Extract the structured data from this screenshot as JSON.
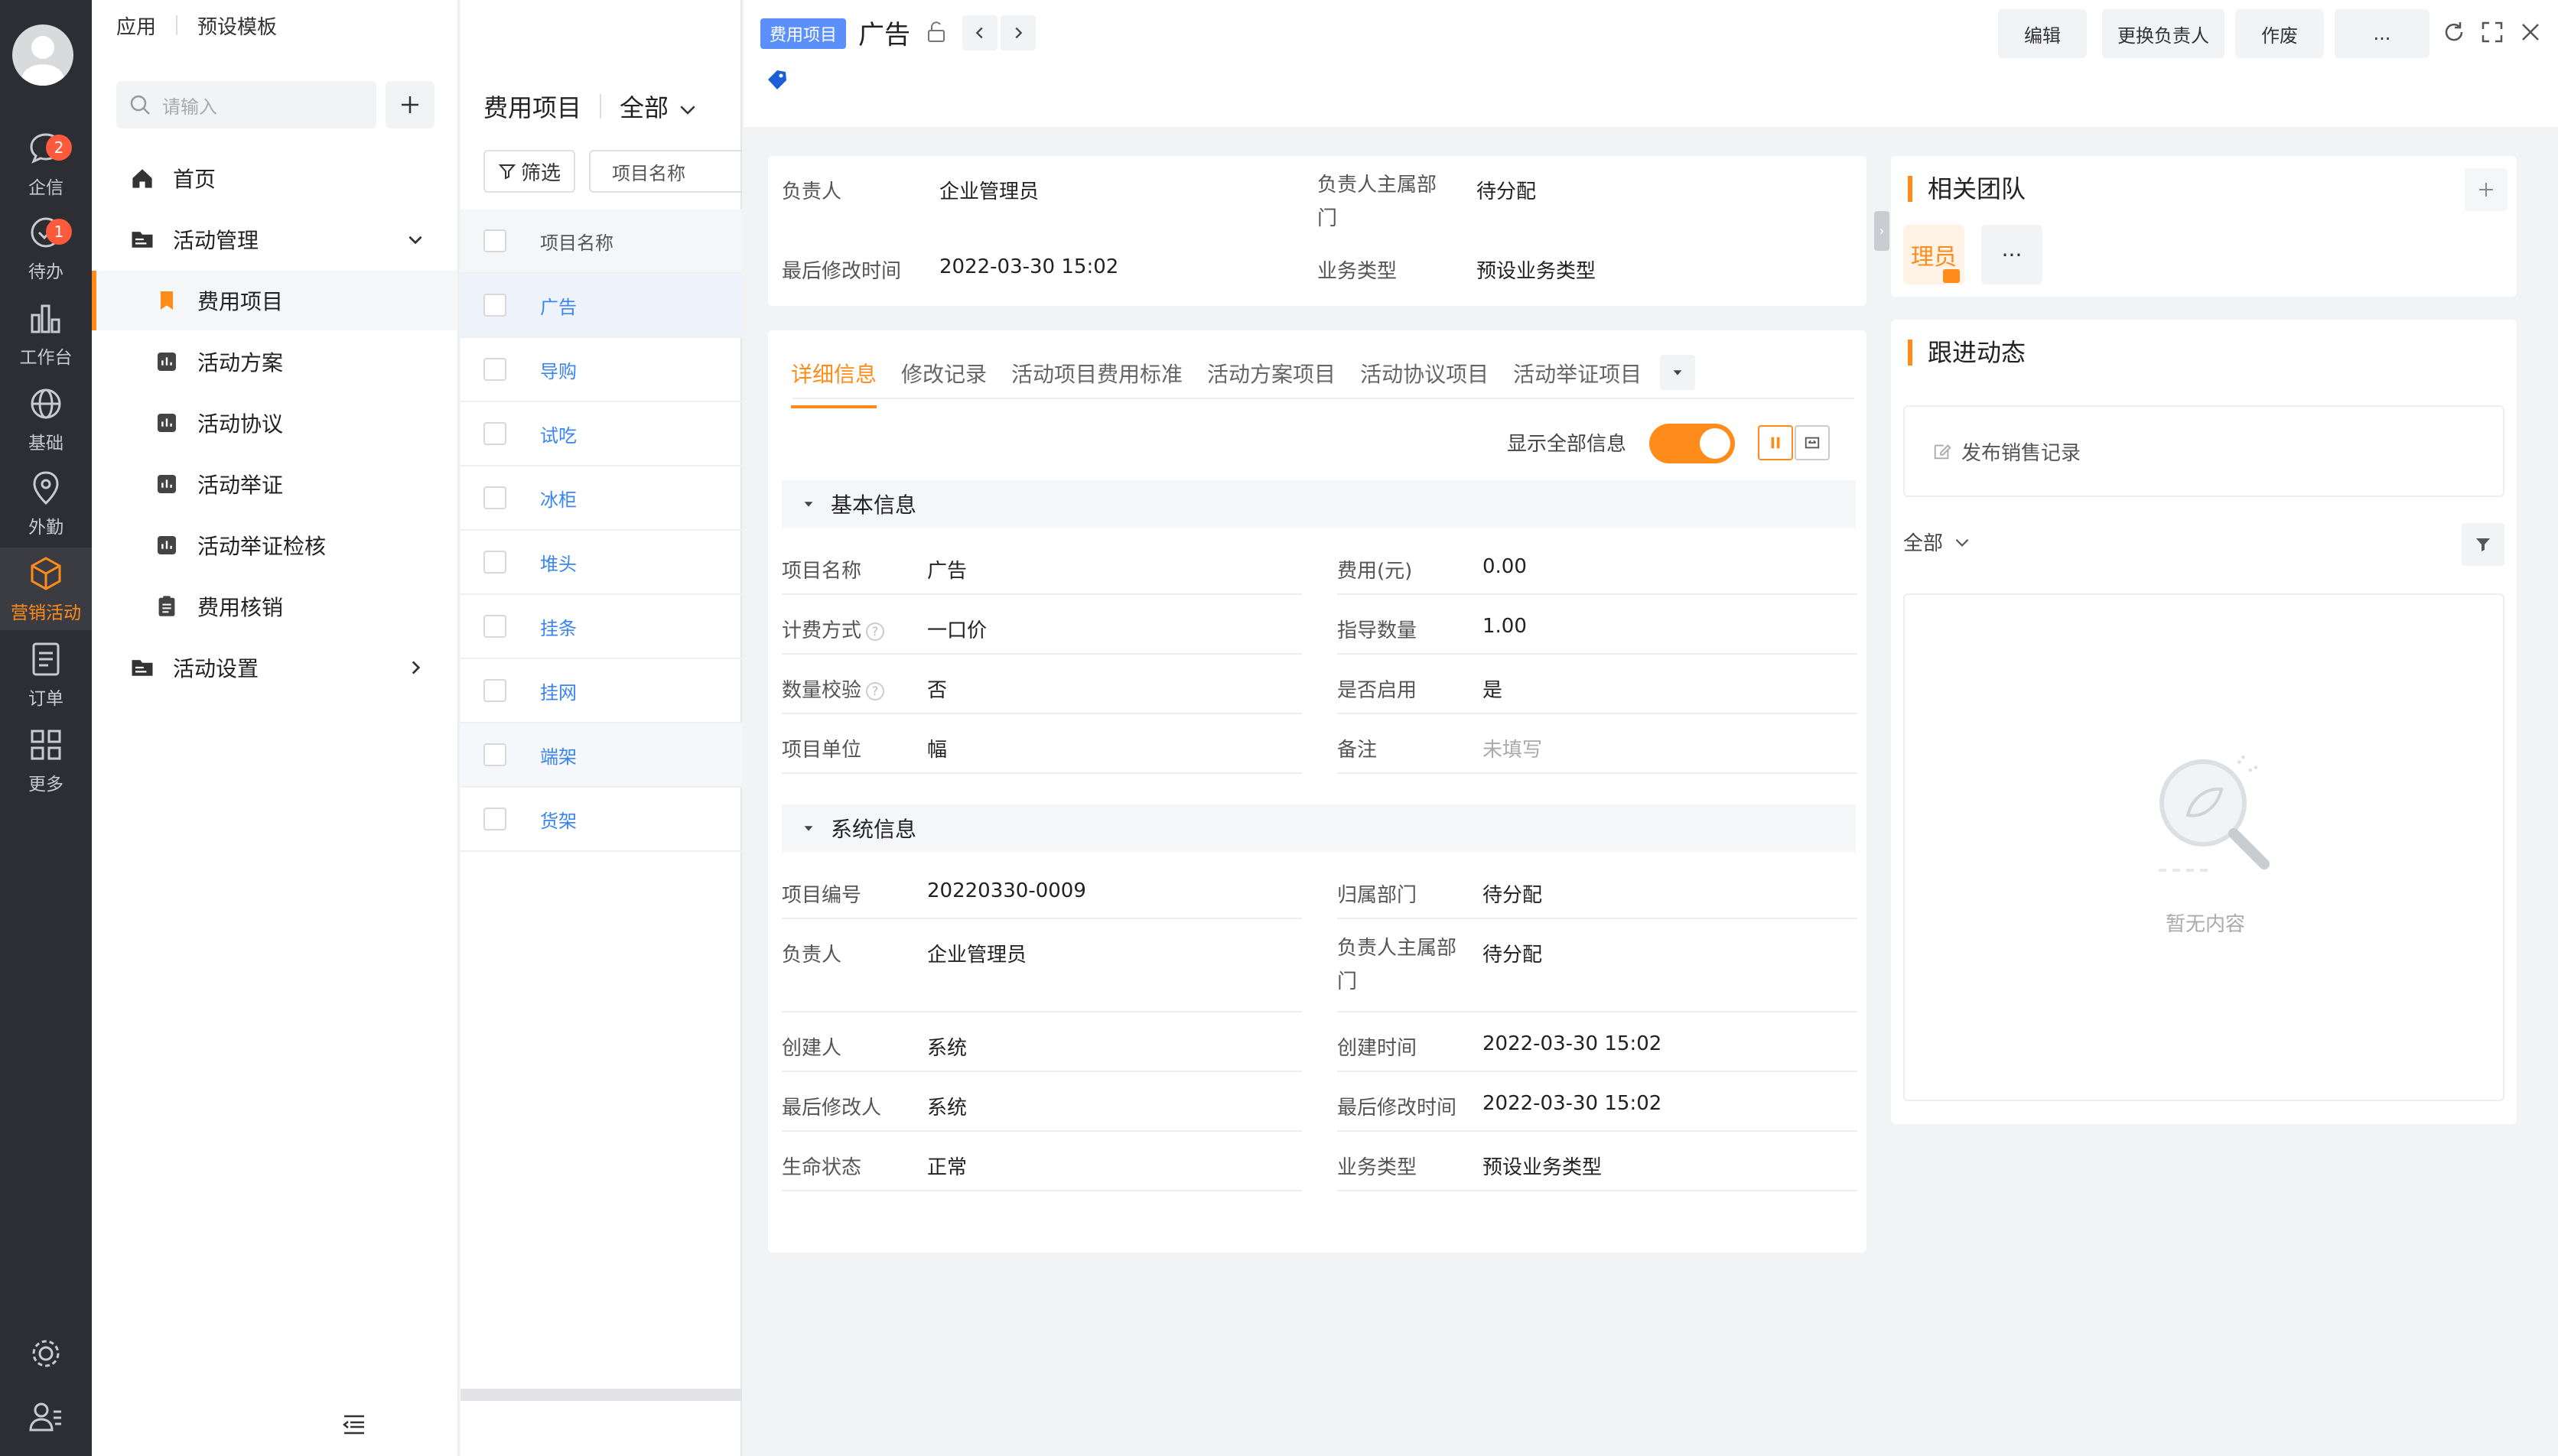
{
  "rail": {
    "items": [
      {
        "label": "企信",
        "badge": "2"
      },
      {
        "label": "待办",
        "badge": "1"
      },
      {
        "label": "工作台"
      },
      {
        "label": "基础"
      },
      {
        "label": "外勤"
      },
      {
        "label": "营销活动"
      },
      {
        "label": "订单"
      },
      {
        "label": "更多"
      }
    ]
  },
  "menu": {
    "top_app": "应用",
    "top_template": "预设模板",
    "search_placeholder": "请输入",
    "items": [
      "首页",
      "活动管理",
      "费用项目",
      "活动方案",
      "活动协议",
      "活动举证",
      "活动举证检核",
      "费用核销",
      "活动设置"
    ]
  },
  "list": {
    "object_name": "费用项目",
    "scope": "全部",
    "filter_label": "筛选",
    "sort_label": "项目名称",
    "column_header": "项目名称",
    "rows": [
      "广告",
      "导购",
      "试吃",
      "冰柜",
      "堆头",
      "挂条",
      "挂网",
      "端架",
      "货架"
    ]
  },
  "detail": {
    "tag": "费用项目",
    "title": "广告",
    "actions": [
      "编辑",
      "更换负责人",
      "作废",
      "..."
    ],
    "summary": {
      "owner_label": "负责人",
      "owner_value": "企业管理员",
      "dept_label": "负责人主属部门",
      "dept_value": "待分配",
      "modified_label": "最后修改时间",
      "modified_value": "2022-03-30 15:02",
      "biztype_label": "业务类型",
      "biztype_value": "预设业务类型"
    },
    "tabs": [
      "详细信息",
      "修改记录",
      "活动项目费用标准",
      "活动方案项目",
      "活动协议项目",
      "活动举证项目"
    ],
    "show_all_label": "显示全部信息",
    "basic_section": "基本信息",
    "basic_fields": [
      {
        "l": "项目名称",
        "v": "广告"
      },
      {
        "l": "费用(元)",
        "v": "0.00"
      },
      {
        "l": "计费方式",
        "v": "一口价"
      },
      {
        "l": "指导数量",
        "v": "1.00"
      },
      {
        "l": "数量校验",
        "v": "否"
      },
      {
        "l": "是否启用",
        "v": "是"
      },
      {
        "l": "项目单位",
        "v": "幅"
      },
      {
        "l": "备注",
        "v": "未填写"
      }
    ],
    "system_section": "系统信息",
    "system_fields": [
      {
        "l": "项目编号",
        "v": "20220330-0009"
      },
      {
        "l": "归属部门",
        "v": "待分配"
      },
      {
        "l": "负责人",
        "v": "企业管理员"
      },
      {
        "l": "负责人主属部门",
        "v": "待分配"
      },
      {
        "l": "创建人",
        "v": "系统"
      },
      {
        "l": "创建时间",
        "v": "2022-03-30 15:02"
      },
      {
        "l": "最后修改人",
        "v": "系统"
      },
      {
        "l": "最后修改时间",
        "v": "2022-03-30 15:02"
      },
      {
        "l": "生命状态",
        "v": "正常"
      },
      {
        "l": "业务类型",
        "v": "预设业务类型"
      }
    ]
  },
  "side": {
    "team_title": "相关团队",
    "team_member": "理员",
    "team_more": "···",
    "follow_title": "跟进动态",
    "publish_label": "发布销售记录",
    "follow_scope": "全部",
    "empty_text": "暂无内容"
  },
  "colors": {
    "accent": "#ff8c1a",
    "link": "#3a85f0",
    "tag": "#5b8ff9",
    "rail": "#2c2e33"
  }
}
